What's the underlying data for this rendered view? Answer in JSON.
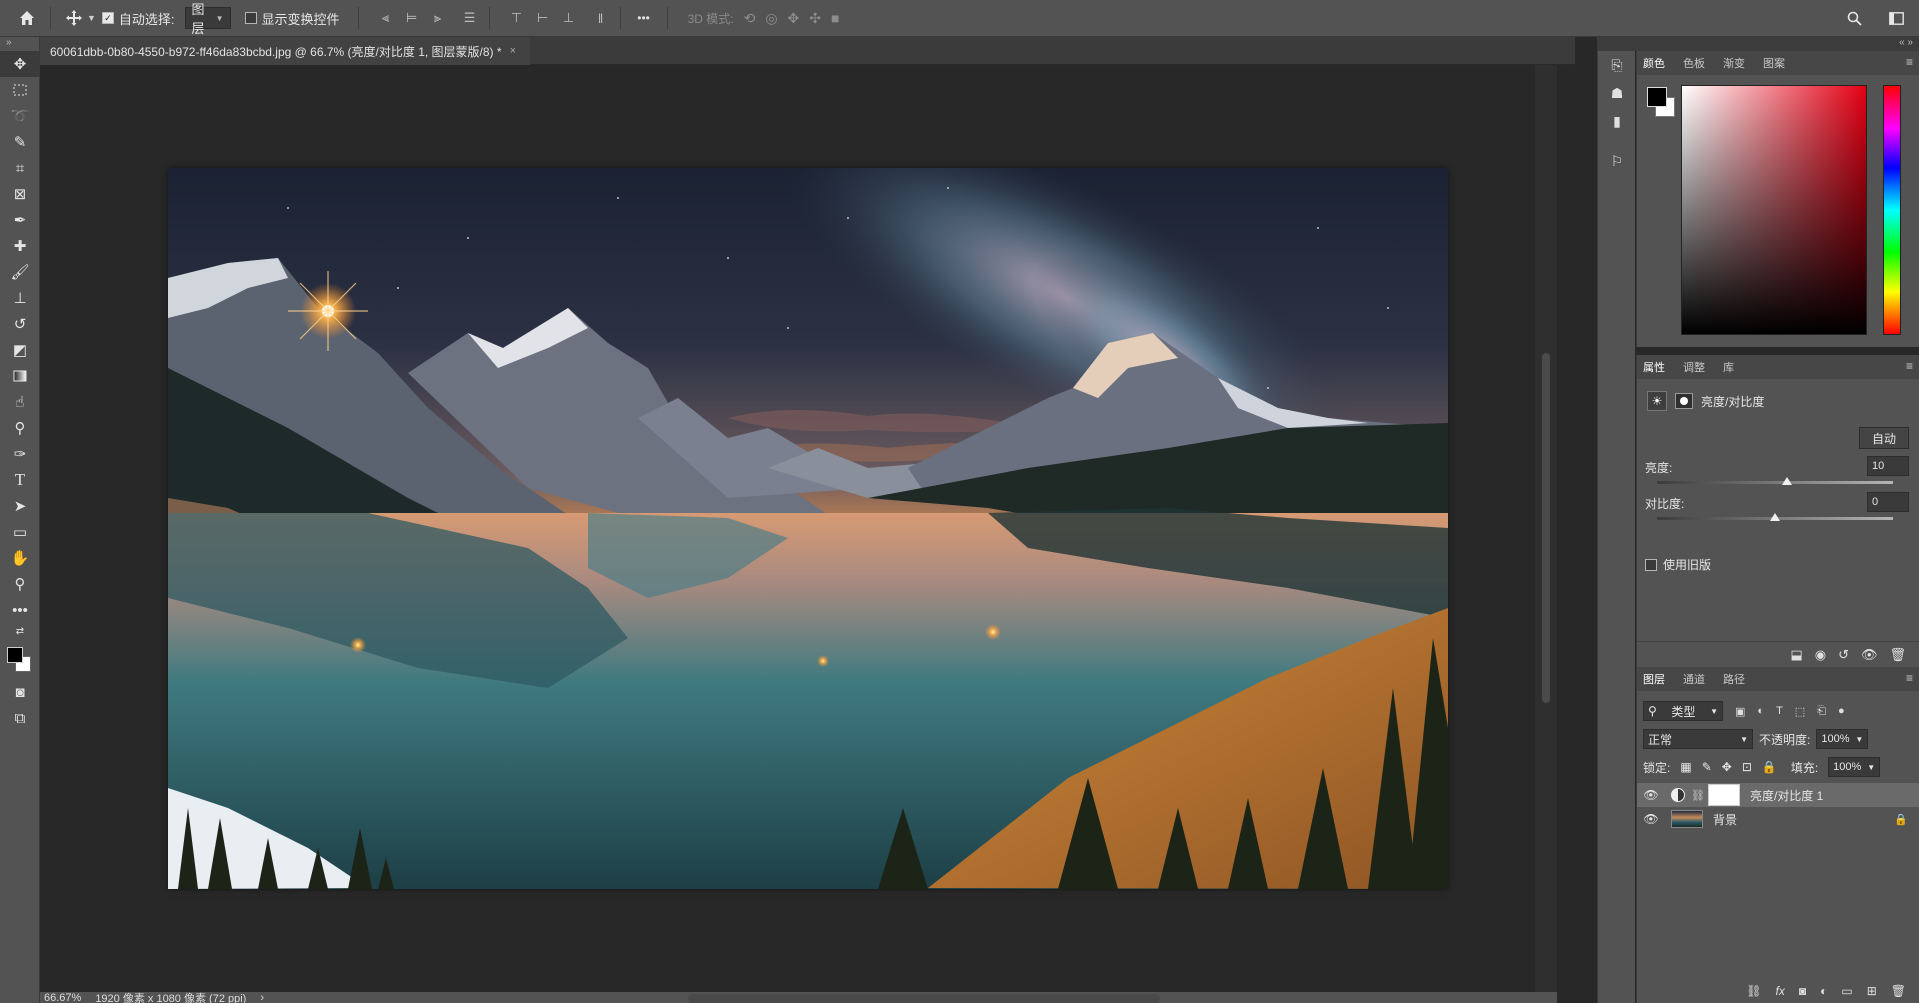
{
  "options_bar": {
    "home_icon": "home-icon",
    "move_icon": "move-tool-icon",
    "auto_select_label": "自动选择:",
    "auto_select_checked": true,
    "auto_select_target": "图层",
    "show_transform_label": "显示变换控件",
    "show_transform_checked": false,
    "more_label": "•••",
    "mode_3d_label": "3D 模式:"
  },
  "document_tab": {
    "title": "60061dbb-0b80-4550-b972-ff46da83bcbd.jpg @ 66.7% (亮度/对比度 1, 图层蒙版/8) *",
    "close": "×"
  },
  "left_tools": [
    "move-tool",
    "marquee-tool",
    "lasso-tool",
    "quick-select-tool",
    "crop-tool",
    "frame-tool",
    "eyedropper-tool",
    "healing-brush-tool",
    "brush-tool",
    "stamp-tool",
    "history-brush-tool",
    "eraser-tool",
    "gradient-tool",
    "smudge-tool",
    "dodge-tool",
    "pen-tool",
    "type-tool",
    "path-select-tool",
    "rectangle-tool",
    "hand-tool",
    "zoom-tool",
    "edit-toolbar"
  ],
  "type_tool_glyph": "T",
  "status": {
    "zoom": "66.67%",
    "doc_info": "1920 像素 x 1080 像素 (72 ppi)",
    "arrow": "›"
  },
  "color_panel": {
    "tabs": [
      "颜色",
      "色板",
      "渐变",
      "图案"
    ],
    "active_tab": 0,
    "foreground": "#000000",
    "background": "#ffffff",
    "hue_color": "#e40014"
  },
  "properties_panel": {
    "tabs": [
      "属性",
      "调整",
      "库"
    ],
    "active_tab": 0,
    "adjustment_title": "亮度/对比度",
    "auto_label": "自动",
    "brightness_label": "亮度:",
    "brightness_value": "10",
    "brightness_level": 0.55,
    "contrast_label": "对比度:",
    "contrast_value": "0",
    "contrast_level": 0.5,
    "legacy_label": "使用旧版",
    "legacy_checked": false
  },
  "layers_panel": {
    "tabs": [
      "图层",
      "通道",
      "路径"
    ],
    "active_tab": 0,
    "filter_label": "类型",
    "blend_mode": "正常",
    "opacity_label": "不透明度:",
    "opacity_value": "100%",
    "lock_label": "锁定:",
    "fill_label": "填充:",
    "fill_value": "100%",
    "layers": [
      {
        "name": "亮度/对比度 1",
        "selected": true,
        "visible": true
      },
      {
        "name": "背景",
        "selected": false,
        "visible": true,
        "locked": true
      }
    ]
  }
}
